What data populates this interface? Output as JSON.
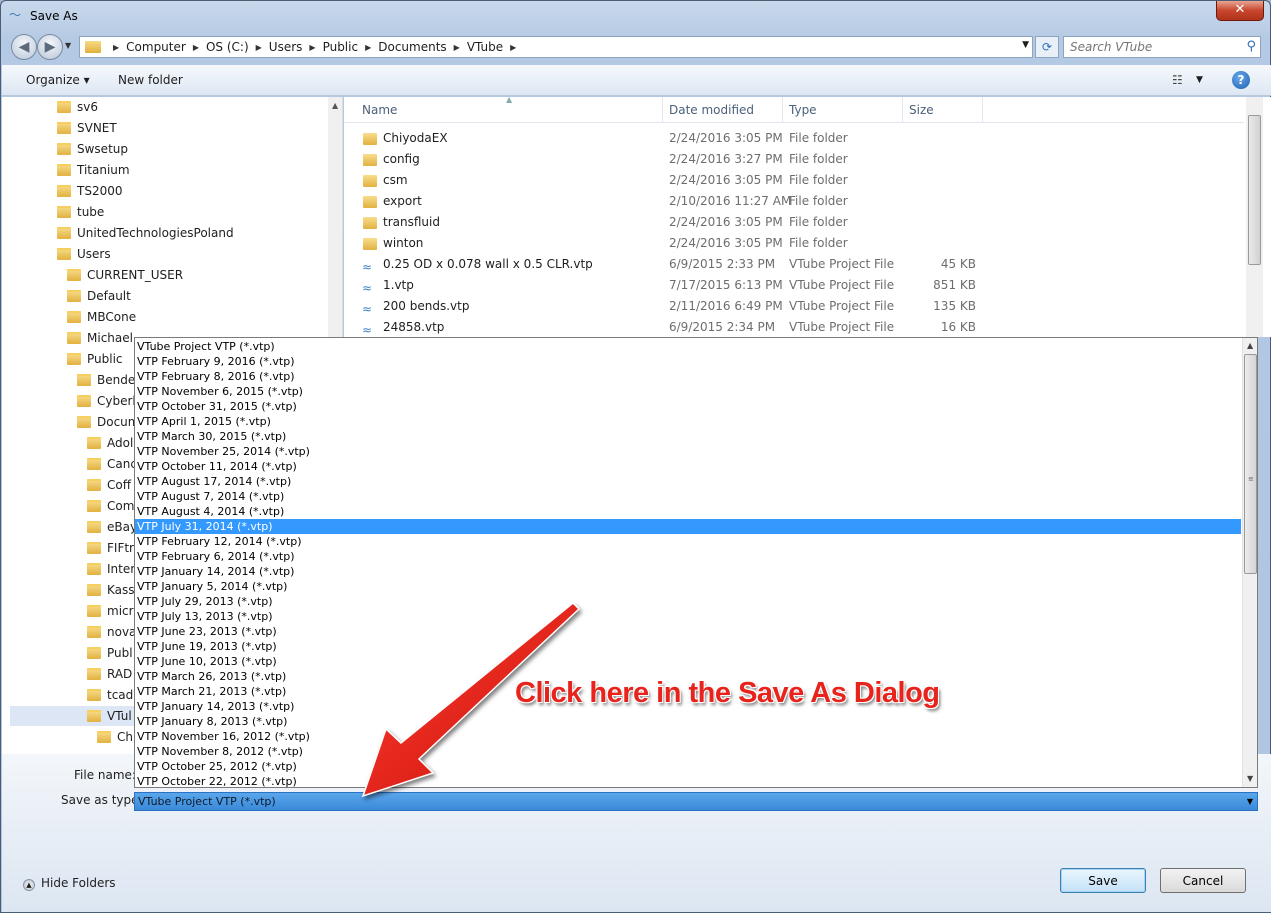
{
  "window": {
    "title": "Save As",
    "close_glyph": "✕"
  },
  "address": {
    "crumbs": [
      "Computer",
      "OS (C:)",
      "Users",
      "Public",
      "Documents",
      "VTube"
    ]
  },
  "search": {
    "placeholder": "Search VTube"
  },
  "toolbar": {
    "organize_label": "Organize ▾",
    "new_folder_label": "New folder"
  },
  "tree": [
    {
      "label": "sv6",
      "indent": 0
    },
    {
      "label": "SVNET",
      "indent": 0
    },
    {
      "label": "Swsetup",
      "indent": 0
    },
    {
      "label": "Titanium",
      "indent": 0
    },
    {
      "label": "TS2000",
      "indent": 0
    },
    {
      "label": "tube",
      "indent": 0
    },
    {
      "label": "UnitedTechnologiesPoland",
      "indent": 0
    },
    {
      "label": "Users",
      "indent": 0
    },
    {
      "label": "CURRENT_USER",
      "indent": 1
    },
    {
      "label": "Default",
      "indent": 1
    },
    {
      "label": "MBCone",
      "indent": 1
    },
    {
      "label": "Michael",
      "indent": 1
    },
    {
      "label": "Public",
      "indent": 1
    },
    {
      "label": "Bende",
      "indent": 2
    },
    {
      "label": "Cyberl",
      "indent": 2
    },
    {
      "label": "Docum",
      "indent": 2
    },
    {
      "label": "Adol",
      "indent": 3
    },
    {
      "label": "Canc",
      "indent": 3
    },
    {
      "label": "Coff",
      "indent": 3
    },
    {
      "label": "Com",
      "indent": 3
    },
    {
      "label": "eBay",
      "indent": 3
    },
    {
      "label": "FIFtr",
      "indent": 3
    },
    {
      "label": "Inter",
      "indent": 3
    },
    {
      "label": "Kass",
      "indent": 3
    },
    {
      "label": "micr",
      "indent": 3
    },
    {
      "label": "nova",
      "indent": 3
    },
    {
      "label": "Publ",
      "indent": 3
    },
    {
      "label": "RAD",
      "indent": 3
    },
    {
      "label": "tcad",
      "indent": 3
    },
    {
      "label": "VTul",
      "indent": 3,
      "selected": true
    },
    {
      "label": "Ch",
      "indent": 4
    }
  ],
  "columns": {
    "name": "Name",
    "date": "Date modified",
    "type": "Type",
    "size": "Size"
  },
  "files": [
    {
      "name": "ChiyodaEX",
      "date": "2/24/2016 3:05 PM",
      "type": "File folder",
      "size": "",
      "kind": "folder"
    },
    {
      "name": "config",
      "date": "2/24/2016 3:27 PM",
      "type": "File folder",
      "size": "",
      "kind": "folder"
    },
    {
      "name": "csm",
      "date": "2/24/2016 3:05 PM",
      "type": "File folder",
      "size": "",
      "kind": "folder"
    },
    {
      "name": "export",
      "date": "2/10/2016 11:27 AM",
      "type": "File folder",
      "size": "",
      "kind": "folder"
    },
    {
      "name": "transfluid",
      "date": "2/24/2016 3:05 PM",
      "type": "File folder",
      "size": "",
      "kind": "folder"
    },
    {
      "name": "winton",
      "date": "2/24/2016 3:05 PM",
      "type": "File folder",
      "size": "",
      "kind": "folder"
    },
    {
      "name": "0.25 OD x 0.078 wall x 0.5 CLR.vtp",
      "date": "6/9/2015 2:33 PM",
      "type": "VTube Project File",
      "size": "45 KB",
      "kind": "vtp"
    },
    {
      "name": "1.vtp",
      "date": "7/17/2015 6:13 PM",
      "type": "VTube Project File",
      "size": "851 KB",
      "kind": "vtp"
    },
    {
      "name": "200 bends.vtp",
      "date": "2/11/2016 6:49 PM",
      "type": "VTube Project File",
      "size": "135 KB",
      "kind": "vtp"
    },
    {
      "name": "24858.vtp",
      "date": "6/9/2015 2:34 PM",
      "type": "VTube Project File",
      "size": "16 KB",
      "kind": "vtp"
    }
  ],
  "save_type_options": [
    "VTube Project VTP (*.vtp)",
    "VTP February 9, 2016 (*.vtp)",
    "VTP February 8, 2016 (*.vtp)",
    "VTP November 6, 2015 (*.vtp)",
    "VTP October 31, 2015 (*.vtp)",
    "VTP April 1, 2015 (*.vtp)",
    "VTP March 30, 2015 (*.vtp)",
    "VTP November 25, 2014 (*.vtp)",
    "VTP October 11, 2014 (*.vtp)",
    "VTP August 17, 2014 (*.vtp)",
    "VTP August 7, 2014 (*.vtp)",
    "VTP August 4, 2014 (*.vtp)",
    "VTP July 31, 2014 (*.vtp)",
    "VTP February 12, 2014 (*.vtp)",
    "VTP February 6, 2014 (*.vtp)",
    "VTP January 14, 2014 (*.vtp)",
    "VTP January 5, 2014 (*.vtp)",
    "VTP July 29, 2013 (*.vtp)",
    "VTP July 13, 2013 (*.vtp)",
    "VTP June 23, 2013 (*.vtp)",
    "VTP June 19, 2013 (*.vtp)",
    "VTP June 10, 2013 (*.vtp)",
    "VTP March 26, 2013 (*.vtp)",
    "VTP March 21, 2013 (*.vtp)",
    "VTP January 14, 2013 (*.vtp)",
    "VTP January 8, 2013 (*.vtp)",
    "VTP November 16, 2012 (*.vtp)",
    "VTP November 8, 2012 (*.vtp)",
    "VTP October 25, 2012 (*.vtp)",
    "VTP October 22, 2012 (*.vtp)"
  ],
  "highlighted_option": "VTP July 31, 2014 (*.vtp)",
  "form": {
    "file_name_label": "File name:",
    "save_type_label": "Save as type:",
    "save_type_value": "VTube Project VTP (*.vtp)"
  },
  "footer": {
    "hide_folders_label": "Hide Folders",
    "save_label": "Save",
    "cancel_label": "Cancel"
  },
  "annotation": {
    "text": "Click here in the Save As Dialog",
    "color": "#e8231c"
  },
  "icons": {
    "back": "◀",
    "forward": "▶",
    "refresh": "⟳",
    "search": "⚲",
    "help": "?",
    "view": "☷",
    "dropdown": "▼",
    "up": "▲"
  }
}
